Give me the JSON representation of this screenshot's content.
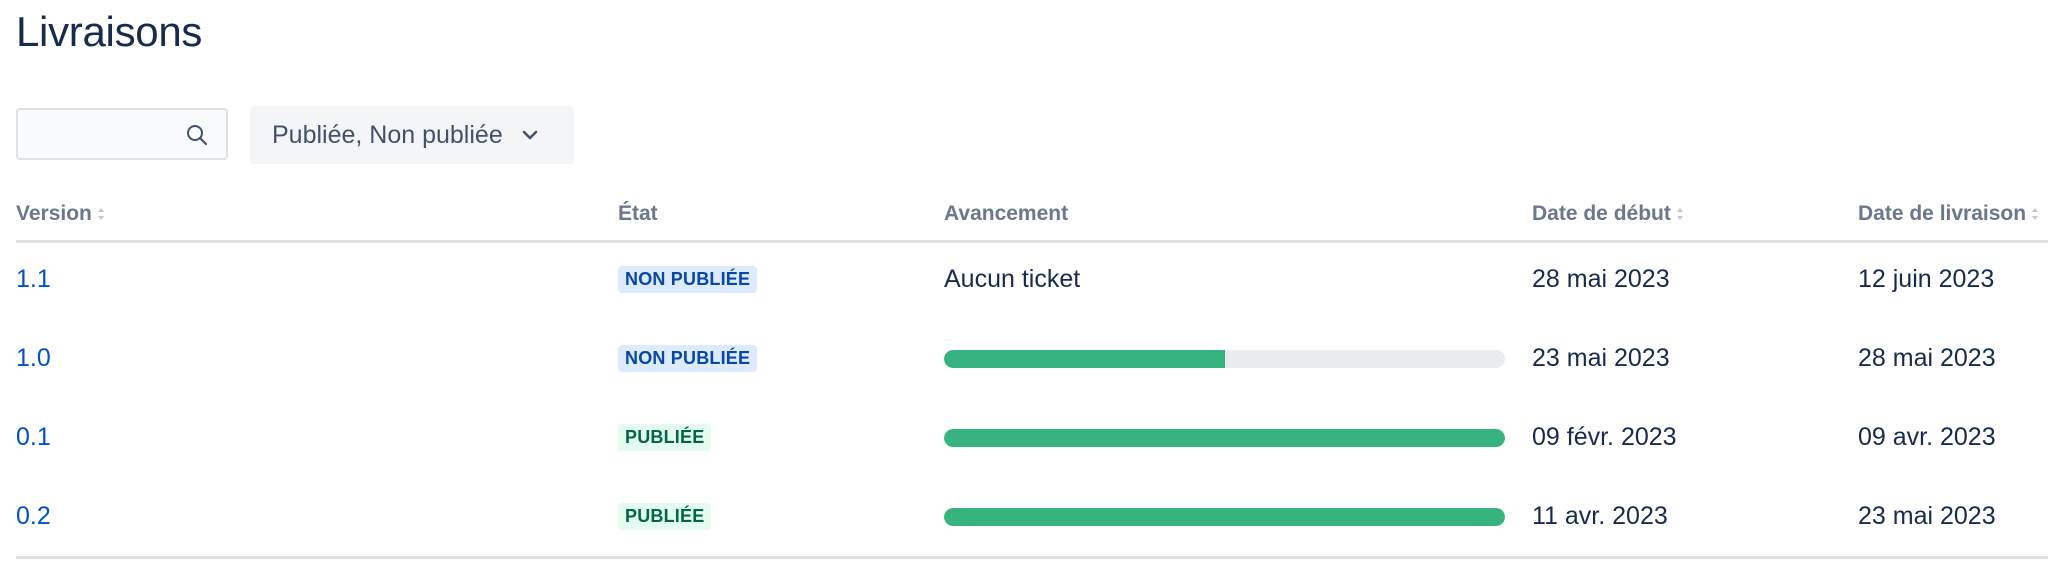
{
  "page": {
    "title": "Livraisons"
  },
  "search": {
    "placeholder": ""
  },
  "filter": {
    "label": "Publiée, Non publiée"
  },
  "table": {
    "headers": {
      "version": "Version",
      "status": "État",
      "progress": "Avancement",
      "start_date": "Date de début",
      "release_date": "Date de livraison"
    },
    "rows": [
      {
        "version": "1.1",
        "status": "NON PUBLIÉE",
        "status_type": "unreleased",
        "progress_text": "Aucun ticket",
        "progress": null,
        "start_date": "28 mai 2023",
        "release_date": "12 juin 2023"
      },
      {
        "version": "1.0",
        "status": "NON PUBLIÉE",
        "status_type": "unreleased",
        "progress_text": "",
        "progress": 0.5,
        "start_date": "23 mai 2023",
        "release_date": "28 mai 2023"
      },
      {
        "version": "0.1",
        "status": "PUBLIÉE",
        "status_type": "released",
        "progress_text": "",
        "progress": 1.0,
        "start_date": "09 févr. 2023",
        "release_date": "09 avr. 2023"
      },
      {
        "version": "0.2",
        "status": "PUBLIÉE",
        "status_type": "released",
        "progress_text": "",
        "progress": 1.0,
        "start_date": "11 avr. 2023",
        "release_date": "23 mai 2023"
      }
    ]
  },
  "colors": {
    "link": "#0052cc",
    "progress_done": "#36b37e",
    "progress_track": "#ebecf0",
    "unreleased_bg": "#deebff",
    "released_bg": "#e3fcef"
  }
}
